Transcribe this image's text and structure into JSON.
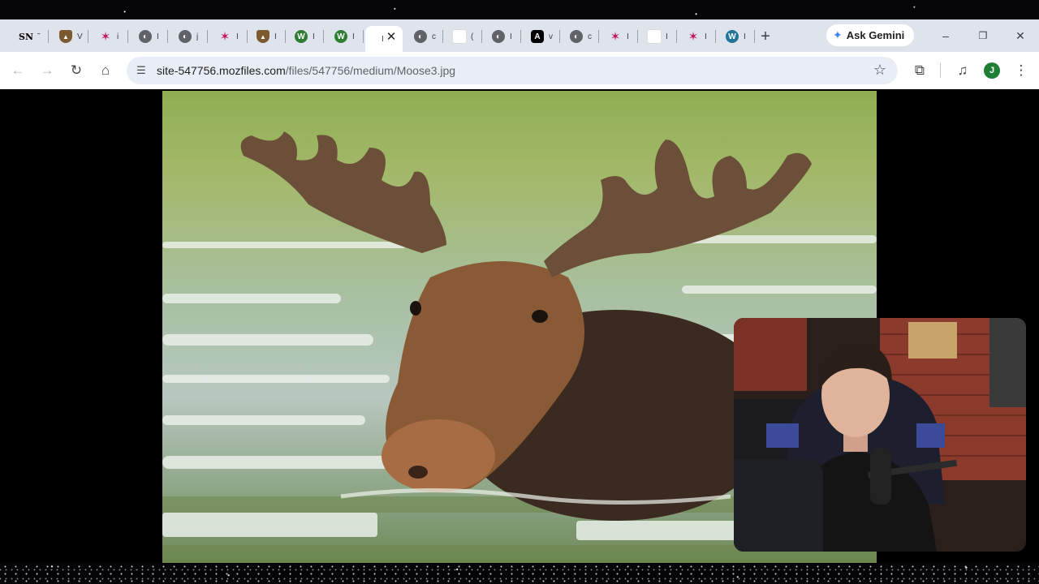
{
  "browser": {
    "tabs": [
      {
        "favicon": "SN",
        "tail": "˜",
        "color": "#000000"
      },
      {
        "favicon": "badge",
        "tail": "V",
        "color": "#7a5a2e"
      },
      {
        "favicon": "✶",
        "tail": "i",
        "color": "#c2185b"
      },
      {
        "favicon": "globe",
        "tail": "I",
        "color": "#5f6368"
      },
      {
        "favicon": "globe",
        "tail": "j",
        "color": "#5f6368"
      },
      {
        "favicon": "✶",
        "tail": "I",
        "color": "#c2185b"
      },
      {
        "favicon": "badge",
        "tail": "I",
        "color": "#7a5a2e"
      },
      {
        "favicon": "W",
        "tail": "I",
        "color": "#2e7d32"
      },
      {
        "favicon": "W",
        "tail": "I",
        "color": "#2e7d32"
      },
      {
        "favicon": "",
        "tail": "I",
        "color": "#ffffff",
        "active": true
      },
      {
        "favicon": "globe",
        "tail": "c",
        "color": "#5f6368"
      },
      {
        "favicon": "blank",
        "tail": "(",
        "color": "#ffffff"
      },
      {
        "favicon": "globe",
        "tail": "I",
        "color": "#5f6368"
      },
      {
        "favicon": "A",
        "tail": "v",
        "color": "#000000"
      },
      {
        "favicon": "globe",
        "tail": "c",
        "color": "#5f6368"
      },
      {
        "favicon": "✶",
        "tail": "I",
        "color": "#c2185b"
      },
      {
        "favicon": "blank",
        "tail": "I",
        "color": "#ffffff"
      },
      {
        "favicon": "✶",
        "tail": "I",
        "color": "#c2185b"
      },
      {
        "favicon": "W",
        "tail": "I",
        "color": "#21759b"
      }
    ],
    "new_tab_label": "+",
    "gemini_label": "Ask Gemini",
    "window_controls": {
      "minimize": "–",
      "restore": "❐",
      "close": "✕"
    }
  },
  "toolbar": {
    "url_host": "site-547756.mozfiles.com",
    "url_path": "/files/547756/medium/Moose3.jpg",
    "profile_initial": "J"
  },
  "content": {
    "image_subject": "moose-in-water-photo",
    "webcam_subject": "webcam-overlay-person"
  }
}
